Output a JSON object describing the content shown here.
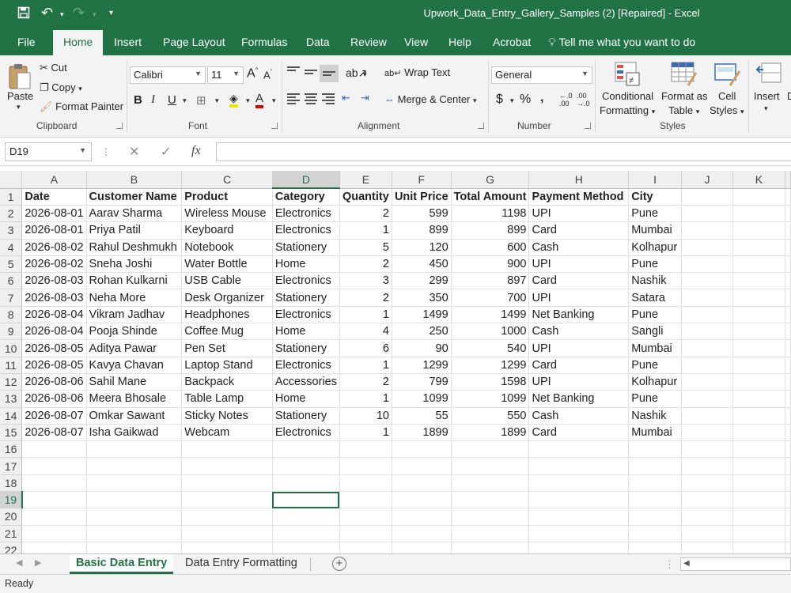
{
  "titlebar": {
    "title": "Upwork_Data_Entry_Gallery_Samples (2) [Repaired]  -  Excel"
  },
  "menu": {
    "tabs": [
      "File",
      "Home",
      "Insert",
      "Page Layout",
      "Formulas",
      "Data",
      "Review",
      "View",
      "Help",
      "Acrobat"
    ],
    "active": "Home",
    "tell_me": "Tell me what you want to do"
  },
  "ribbon": {
    "clipboard": {
      "paste": "Paste",
      "cut": "Cut",
      "copy": "Copy",
      "format_painter": "Format Painter",
      "label": "Clipboard"
    },
    "font": {
      "name": "Calibri",
      "size": "11",
      "label": "Font"
    },
    "alignment": {
      "wrap_text": "Wrap Text",
      "merge_center": "Merge & Center",
      "label": "Alignment"
    },
    "number": {
      "format": "General",
      "label": "Number"
    },
    "styles": {
      "conditional_1": "Conditional",
      "conditional_2": "Formatting",
      "format_as_1": "Format as",
      "format_as_2": "Table",
      "cell_1": "Cell",
      "cell_2": "Styles",
      "label": "Styles"
    },
    "cells": {
      "insert": "Insert"
    }
  },
  "formula_bar": {
    "name_box": "D19",
    "fx": "fx",
    "value": ""
  },
  "sheet": {
    "columns": [
      "A",
      "B",
      "C",
      "D",
      "E",
      "F",
      "G",
      "H",
      "I",
      "J",
      "K"
    ],
    "headers": [
      "Date",
      "Customer Name",
      "Product",
      "Category",
      "Quantity",
      "Unit Price",
      "Total Amount",
      "Payment Method",
      "City"
    ],
    "rows": [
      [
        "2026-08-01",
        "Aarav Sharma",
        "Wireless Mouse",
        "Electronics",
        "2",
        "599",
        "1198",
        "UPI",
        "Pune"
      ],
      [
        "2026-08-01",
        "Priya Patil",
        "Keyboard",
        "Electronics",
        "1",
        "899",
        "899",
        "Card",
        "Mumbai"
      ],
      [
        "2026-08-02",
        "Rahul Deshmukh",
        "Notebook",
        "Stationery",
        "5",
        "120",
        "600",
        "Cash",
        "Kolhapur"
      ],
      [
        "2026-08-02",
        "Sneha Joshi",
        "Water Bottle",
        "Home",
        "2",
        "450",
        "900",
        "UPI",
        "Pune"
      ],
      [
        "2026-08-03",
        "Rohan Kulkarni",
        "USB Cable",
        "Electronics",
        "3",
        "299",
        "897",
        "Card",
        "Nashik"
      ],
      [
        "2026-08-03",
        "Neha More",
        "Desk Organizer",
        "Stationery",
        "2",
        "350",
        "700",
        "UPI",
        "Satara"
      ],
      [
        "2026-08-04",
        "Vikram Jadhav",
        "Headphones",
        "Electronics",
        "1",
        "1499",
        "1499",
        "Net Banking",
        "Pune"
      ],
      [
        "2026-08-04",
        "Pooja Shinde",
        "Coffee Mug",
        "Home",
        "4",
        "250",
        "1000",
        "Cash",
        "Sangli"
      ],
      [
        "2026-08-05",
        "Aditya Pawar",
        "Pen Set",
        "Stationery",
        "6",
        "90",
        "540",
        "UPI",
        "Mumbai"
      ],
      [
        "2026-08-05",
        "Kavya Chavan",
        "Laptop Stand",
        "Electronics",
        "1",
        "1299",
        "1299",
        "Card",
        "Pune"
      ],
      [
        "2026-08-06",
        "Sahil Mane",
        "Backpack",
        "Accessories",
        "2",
        "799",
        "1598",
        "UPI",
        "Kolhapur"
      ],
      [
        "2026-08-06",
        "Meera Bhosale",
        "Table Lamp",
        "Home",
        "1",
        "1099",
        "1099",
        "Net Banking",
        "Pune"
      ],
      [
        "2026-08-07",
        "Omkar Sawant",
        "Sticky Notes",
        "Stationery",
        "10",
        "55",
        "550",
        "Cash",
        "Nashik"
      ],
      [
        "2026-08-07",
        "Isha Gaikwad",
        "Webcam",
        "Electronics",
        "1",
        "1899",
        "1899",
        "Card",
        "Mumbai"
      ]
    ],
    "empty_rows": [
      "16",
      "17",
      "18",
      "19",
      "20",
      "21",
      "22"
    ],
    "selected_row": "19",
    "selected_col": "D"
  },
  "sheet_tabs": {
    "tabs": [
      "Basic Data Entry",
      "Data Entry Formatting"
    ],
    "active": "Basic Data Entry"
  },
  "status": {
    "text": "Ready"
  },
  "colors": {
    "accent": "#217346",
    "selection": "#217346"
  }
}
